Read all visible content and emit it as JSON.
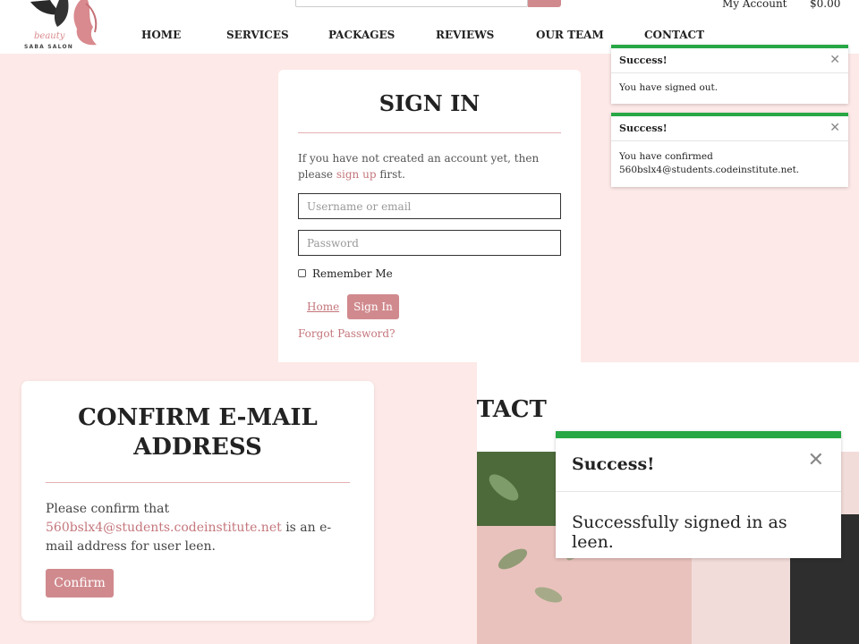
{
  "header": {
    "logo_script": "beauty",
    "logo_text": "SABA SALON",
    "account_label": "My Account",
    "cart_total": "$0.00",
    "nav": [
      "HOME",
      "SERVICES",
      "PACKAGES",
      "REVIEWS",
      "OUR TEAM",
      "CONTACT"
    ]
  },
  "signin": {
    "title": "SIGN IN",
    "intro": "If you have not created an account yet, then please",
    "signup_link": "sign up",
    "intro_end": "first.",
    "username_placeholder": "Username or email",
    "password_placeholder": "Password",
    "remember_label": "Remember Me",
    "home_link": "Home",
    "signin_button": "Sign In",
    "forgot_link": "Forgot Password?"
  },
  "toasts_top": [
    {
      "title": "Success!",
      "message": "You have signed out."
    },
    {
      "title": "Success!",
      "message": "You have confirmed 560bslx4@students.codeinstitute.net."
    }
  ],
  "confirm": {
    "title_line1": "CONFIRM E-MAIL",
    "title_line2": "ADDRESS",
    "text_before": "Please confirm that",
    "email": "560bslx4@students.codeinstitute.net",
    "text_after": "is an e-mail address for user leen.",
    "button": "Confirm"
  },
  "contact": {
    "title_partial": "NTACT"
  },
  "toast_large": {
    "title": "Success!",
    "message": "Successfully signed in as leen."
  },
  "colors": {
    "accent_pink": "#d08a8e",
    "background_pink": "#fde9e7",
    "success_green": "#28a745"
  }
}
